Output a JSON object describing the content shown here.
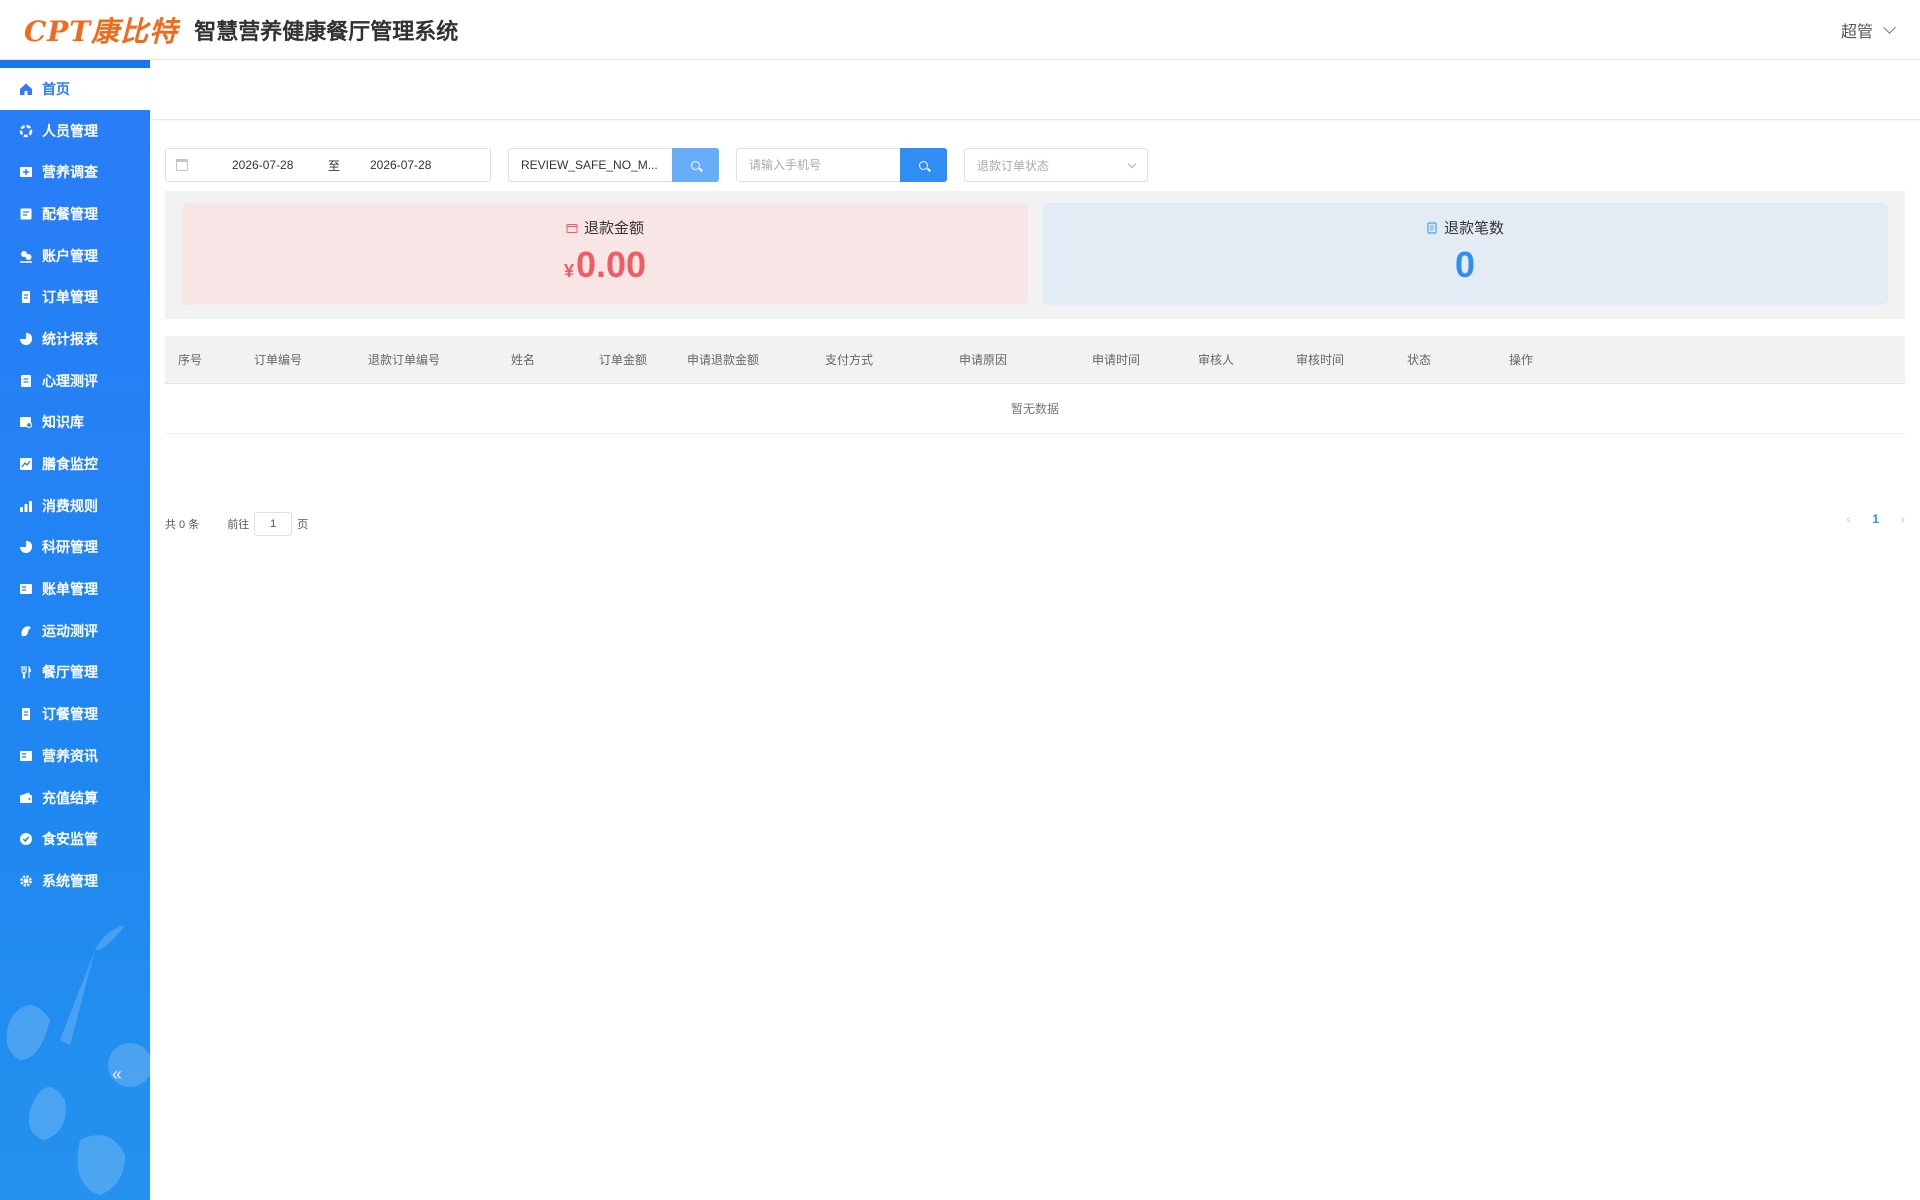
{
  "header": {
    "logo": "CPT康比特",
    "title": "智慧营养健康餐厅管理系统",
    "user": "超管"
  },
  "sidebar": {
    "items": [
      {
        "label": "首页",
        "icon": "home-icon"
      },
      {
        "label": "人员管理",
        "icon": "people-icon"
      },
      {
        "label": "营养调查",
        "icon": "survey-icon"
      },
      {
        "label": "配餐管理",
        "icon": "meal-plan-icon"
      },
      {
        "label": "账户管理",
        "icon": "account-icon"
      },
      {
        "label": "订单管理",
        "icon": "order-icon"
      },
      {
        "label": "统计报表",
        "icon": "pie-chart-icon"
      },
      {
        "label": "心理测评",
        "icon": "psych-icon"
      },
      {
        "label": "知识库",
        "icon": "knowledge-icon"
      },
      {
        "label": "膳食监控",
        "icon": "line-chart-icon"
      },
      {
        "label": "消费规则",
        "icon": "bar-chart-icon"
      },
      {
        "label": "科研管理",
        "icon": "research-icon"
      },
      {
        "label": "账单管理",
        "icon": "bill-icon"
      },
      {
        "label": "运动测评",
        "icon": "exercise-icon"
      },
      {
        "label": "餐厅管理",
        "icon": "fork-knife-icon"
      },
      {
        "label": "订餐管理",
        "icon": "booking-icon"
      },
      {
        "label": "营养资讯",
        "icon": "news-icon"
      },
      {
        "label": "充值结算",
        "icon": "wallet-icon"
      },
      {
        "label": "食安监管",
        "icon": "shield-icon"
      },
      {
        "label": "系统管理",
        "icon": "gear-icon"
      }
    ],
    "collapse": "«"
  },
  "filters": {
    "date_start": "2026-07-28",
    "date_sep": "至",
    "date_end": "2026-07-28",
    "keyword_value": "REVIEW_SAFE_NO_M...",
    "phone_placeholder": "请输入手机号",
    "status_placeholder": "退款订单状态"
  },
  "stats": {
    "refund_amount_label": "退款金额",
    "refund_amount_currency": "¥",
    "refund_amount_value": "0.00",
    "refund_count_label": "退款笔数",
    "refund_count_value": "0"
  },
  "table": {
    "columns": [
      "序号",
      "订单编号",
      "退款订单编号",
      "姓名",
      "订单金额",
      "申请退款金额",
      "支付方式",
      "申请原因",
      "申请时间",
      "审核人",
      "审核时间",
      "状态",
      "操作"
    ],
    "empty_text": "暂无数据"
  },
  "pagination": {
    "total": "共 0 条",
    "goto": "前往",
    "page_value": "1",
    "page_unit": "页",
    "current": "1",
    "prev": "‹",
    "next": "›"
  },
  "colors": {
    "primary": "#2f8df4",
    "sidebar": "#2a7cf7",
    "logo": "#f26a1b",
    "refund_amount": "#f05c63"
  }
}
